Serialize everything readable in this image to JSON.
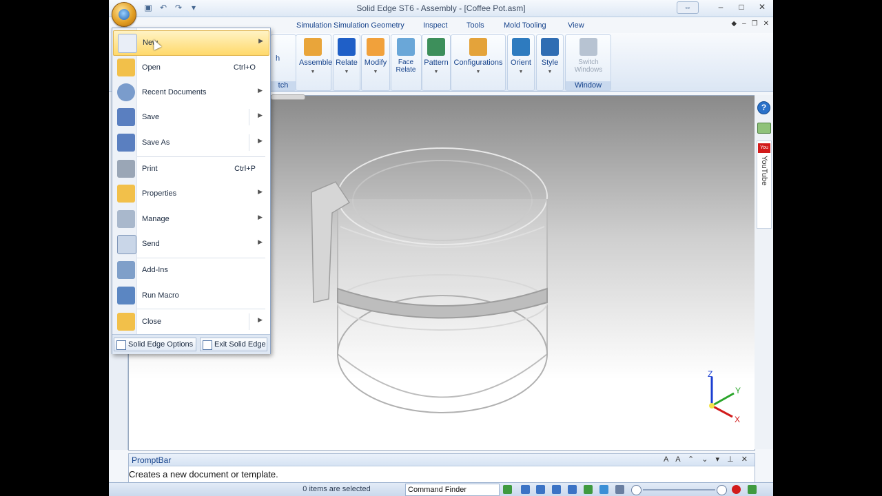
{
  "window": {
    "title": "Solid Edge ST6 - Assembly - [Coffee Pot.asm]",
    "controls": [
      "⇔",
      "–",
      "□",
      "✕"
    ]
  },
  "qat": [
    "save-icon",
    "undo-icon",
    "redo-icon",
    "customize-icon"
  ],
  "tabs": [
    "Simulation",
    "Simulation Geometry",
    "Inspect",
    "Tools",
    "Mold Tooling",
    "View"
  ],
  "ribbon": {
    "partial_group_label": "tch",
    "partial_btn_label": "h",
    "buttons": [
      {
        "label": "Assemble",
        "icon": "assemble-icon",
        "color": "#e9a53a"
      },
      {
        "label": "Relate",
        "icon": "relate-icon",
        "color": "#1f5fc7"
      },
      {
        "label": "Modify",
        "icon": "modify-icon",
        "color": "#f1a13b"
      },
      {
        "label": "Face Relate",
        "icon": "face-relate-icon",
        "color": "#6aa7d8"
      },
      {
        "label": "Pattern",
        "icon": "pattern-icon",
        "color": "#3d8f5b"
      },
      {
        "label": "Configurations",
        "icon": "configurations-icon",
        "color": "#e4a33a"
      },
      {
        "label": "Orient",
        "icon": "orient-icon",
        "color": "#2e7bbf"
      },
      {
        "label": "Style",
        "icon": "style-icon",
        "color": "#2f6db3"
      },
      {
        "label": "Switch Windows",
        "icon": "switch-windows-icon",
        "color": "#b7c3d2"
      }
    ],
    "window_group_label": "Window"
  },
  "app_menu": {
    "items": [
      {
        "label": "New",
        "shortcut": "",
        "submenu": true,
        "icon": "new-document-icon",
        "color": "#e9eef7"
      },
      {
        "label": "Open",
        "shortcut": "Ctrl+O",
        "submenu": false,
        "icon": "open-folder-icon",
        "color": "#f2c04a"
      },
      {
        "label": "Recent Documents",
        "shortcut": "",
        "submenu": true,
        "icon": "recent-documents-icon",
        "color": "#7a9ccc"
      },
      {
        "label": "Save",
        "shortcut": "",
        "submenu": true,
        "icon": "save-icon",
        "color": "#5a7fc0"
      },
      {
        "label": "Save As",
        "shortcut": "",
        "submenu": true,
        "icon": "save-as-icon",
        "color": "#5a7fc0"
      },
      {
        "label": "Print",
        "shortcut": "Ctrl+P",
        "submenu": false,
        "icon": "print-icon",
        "color": "#9aa6b6"
      },
      {
        "label": "Properties",
        "shortcut": "",
        "submenu": true,
        "icon": "properties-icon",
        "color": "#f2c04a"
      },
      {
        "label": "Manage",
        "shortcut": "",
        "submenu": true,
        "icon": "manage-icon",
        "color": "#a9b8cc"
      },
      {
        "label": "Send",
        "shortcut": "",
        "submenu": true,
        "icon": "send-icon",
        "color": "#c9d6e8"
      },
      {
        "label": "Add-Ins",
        "shortcut": "",
        "submenu": false,
        "icon": "add-ins-icon",
        "color": "#7f9fc9"
      },
      {
        "label": "Run Macro",
        "shortcut": "",
        "submenu": false,
        "icon": "run-macro-icon",
        "color": "#5b86c2"
      },
      {
        "label": "Close",
        "shortcut": "",
        "submenu": true,
        "icon": "close-folder-icon",
        "color": "#f2c04a"
      }
    ],
    "options_label": "Solid Edge Options",
    "exit_label": "Exit Solid Edge"
  },
  "sidebar_right": {
    "youtube_logo": "You Tube",
    "youtube_label": "YouTube"
  },
  "triad": {
    "z": "Z",
    "y": "Y",
    "x": "X"
  },
  "promptbar": {
    "title": "PromptBar",
    "message": "Creates a new document or template.",
    "controls": "A A ⌃ ⌄ ▾ ⊥ ✕"
  },
  "status": {
    "selection": "0 items are selected",
    "command_finder": "Command Finder"
  },
  "colors": {
    "accent": "#15428b",
    "highlight": "#ffd96b",
    "ribbon": "#dbe6f4"
  }
}
